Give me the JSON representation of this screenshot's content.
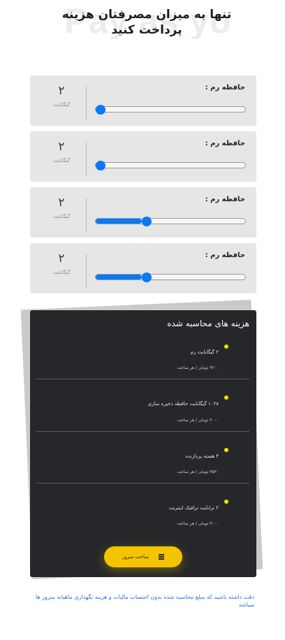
{
  "header": {
    "title_line1": "تنها به میزان مصرفتان هزینه",
    "title_line2": "پرداخت کنید",
    "watermark": "Pay as you go"
  },
  "sliders": [
    {
      "label": "حافظه رم :",
      "value": "۲",
      "unit": "گیگابایت",
      "fraction": 0.0
    },
    {
      "label": "حافظه رم :",
      "value": "۲",
      "unit": "گیگابایت",
      "fraction": 0.0
    },
    {
      "label": "حافظه رم :",
      "value": "۲",
      "unit": "گیگابایت",
      "fraction": 0.31
    },
    {
      "label": "حافظه رم :",
      "value": "۲",
      "unit": "گیگابایت",
      "fraction": 0.31
    }
  ],
  "summary": {
    "title": "هزینه های محاسبه شده",
    "items": [
      {
        "label": "۲ گیگابایت رم",
        "price": "۹۲۰۰ تومان / هر ساعت"
      },
      {
        "label": "۱۰۲۸ گیگابایت حافظه ذخیره سازی",
        "price": "۳۰۰۰ تومان / هر ساعت"
      },
      {
        "label": "۴ هسته پردازنده",
        "price": "۳۵۳۰ تومان / هر ساعت"
      },
      {
        "label": "۲ ترابایت ترافیک اینترنت",
        "price": "۹۰۰۰ تومان / هر ساعت"
      }
    ],
    "button_label": "ساخت سرور",
    "button_icon": "server-icon"
  },
  "note": "دقت داشته باشید که مبلغ محاسبه شده بدون احتساب مالیات و هزینه نگهداری ماهیانه سرور ها میباشد",
  "colors": {
    "accent": "#0b78f5",
    "button": "#f5c400",
    "panel": "#25272a",
    "dot": "#f2e400",
    "note": "#2f6fe0"
  }
}
